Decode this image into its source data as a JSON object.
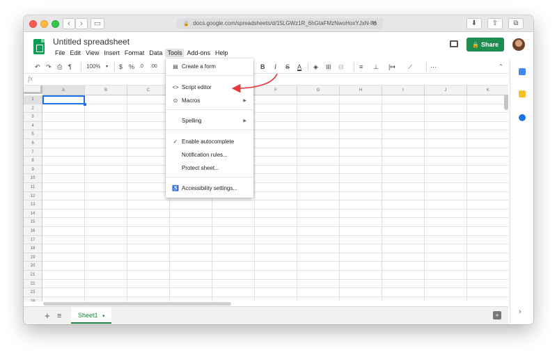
{
  "browser": {
    "address": "docs.google.com/spreadsheets/d/15LGWz1R_6hGtaFMzNwoHoxYJxN-lM",
    "reload_glyph": "↻",
    "lock_glyph": "🔒"
  },
  "doc": {
    "title": "Untitled spreadsheet",
    "share_label": "Share"
  },
  "menubar": [
    "File",
    "Edit",
    "View",
    "Insert",
    "Format",
    "Data",
    "Tools",
    "Add-ons",
    "Help"
  ],
  "toolbar": {
    "zoom": "100%",
    "currency": "$",
    "percent": "%",
    "dec_less": ".0",
    "dec_more": ".00",
    "bold": "B",
    "italic": "I",
    "strike": "S",
    "textcolor": "A",
    "more": "···"
  },
  "formula_bar": {
    "fx": "fx"
  },
  "grid": {
    "columns": [
      "A",
      "B",
      "C",
      "D",
      "E",
      "F",
      "G",
      "H",
      "I",
      "J",
      "K"
    ],
    "rows": [
      "1",
      "2",
      "3",
      "4",
      "5",
      "6",
      "7",
      "8",
      "9",
      "10",
      "11",
      "12",
      "13",
      "14",
      "15",
      "16",
      "17",
      "18",
      "19",
      "20",
      "21",
      "22",
      "23",
      "24"
    ],
    "active_cell": "A1"
  },
  "sheet_tab": {
    "label": "Sheet1",
    "caret": "▾"
  },
  "tools_menu": {
    "items": [
      {
        "label": "Create a form",
        "icon": "form-icon",
        "glyph": "▤"
      },
      {
        "label": "Script editor",
        "icon": "code-icon",
        "glyph": "<>"
      },
      {
        "label": "Macros",
        "icon": "play-circle-icon",
        "glyph": "⊙",
        "submenu": true
      },
      {
        "label": "Spelling",
        "icon": "",
        "glyph": "",
        "submenu": true
      },
      {
        "label": "Enable autocomplete",
        "icon": "check-icon",
        "glyph": "✓"
      },
      {
        "label": "Notification rules...",
        "icon": "",
        "glyph": ""
      },
      {
        "label": "Protect sheet...",
        "icon": "",
        "glyph": ""
      },
      {
        "label": "Accessibility settings...",
        "icon": "accessibility-icon",
        "glyph": "♿"
      }
    ],
    "submenu_arrow": "▶"
  },
  "colors": {
    "share": "#1f8d4f",
    "sheets_green": "#0f9d58",
    "selection_blue": "#1a73e8",
    "annotation_arrow": "#e53935"
  }
}
